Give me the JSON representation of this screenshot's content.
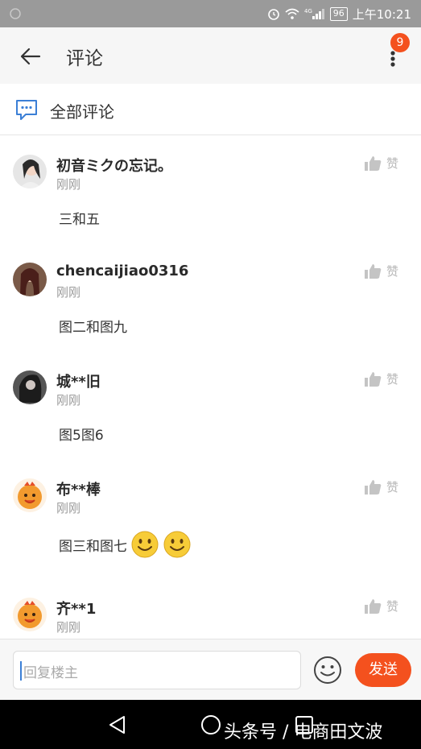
{
  "status_bar": {
    "time": "上午10:21",
    "battery": "96"
  },
  "header": {
    "title": "评论",
    "badge": "9"
  },
  "section": {
    "title": "全部评论"
  },
  "comments": [
    {
      "user": "初音ミクの忘记。",
      "time": "刚刚",
      "like": "赞",
      "text": "三和五",
      "avatar_color": "#d9d9d9"
    },
    {
      "user": "chencaijiao0316",
      "time": "刚刚",
      "like": "赞",
      "text": "图二和图九",
      "avatar_color": "#5a3b2d"
    },
    {
      "user": "城**旧",
      "time": "刚刚",
      "like": "赞",
      "text": "图5图6",
      "avatar_color": "#3a3a3a"
    },
    {
      "user": "布**棒",
      "time": "刚刚",
      "like": "赞",
      "text": "图三和图七",
      "avatar_color": "#f29a2e"
    },
    {
      "user": "齐**1",
      "time": "刚刚",
      "like": "赞",
      "text": "",
      "avatar_color": "#f29a2e"
    }
  ],
  "input": {
    "placeholder": "回复楼主",
    "send_label": "发送"
  },
  "watermark": "头条号 / 电商田文波",
  "colors": {
    "accent": "#f4511e",
    "link_icon": "#3b7fd6"
  }
}
